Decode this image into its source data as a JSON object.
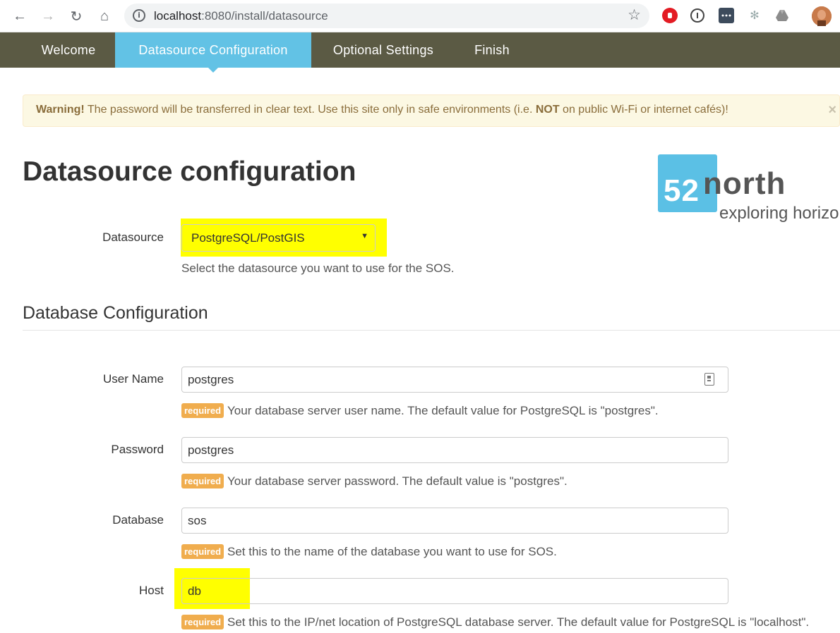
{
  "browser": {
    "url_host": "localhost",
    "url_path": ":8080/install/datasource",
    "back": "←",
    "forward": "→",
    "reload": "↻",
    "home": "⌂",
    "info_glyph": "i",
    "star": "☆",
    "extensions": [
      "stop-icon",
      "password-icon",
      "dots-icon",
      "snowflake-icon",
      "drive-icon",
      "avatar"
    ]
  },
  "nav": {
    "tabs": [
      {
        "label": "Welcome",
        "active": false
      },
      {
        "label": "Datasource Configuration",
        "active": true
      },
      {
        "label": "Optional Settings",
        "active": false
      },
      {
        "label": "Finish",
        "active": false
      }
    ],
    "active_color": "#62c2e5",
    "bar_color": "#5b5a44"
  },
  "alert": {
    "strong": "Warning!",
    "text1": " The password will be transferred in clear text. Use this site only in safe environments (i.e. ",
    "not": "NOT",
    "text2": " on public Wi-Fi or internet cafés)!",
    "close": "×"
  },
  "page_title": "Datasource configuration",
  "logo": {
    "num": "52",
    "word": "north",
    "tagline": "exploring horizons"
  },
  "datasource": {
    "label": "Datasource",
    "value": "PostgreSQL/PostGIS",
    "help": "Select the datasource you want to use for the SOS.",
    "arrow": "▼"
  },
  "section_title": "Database Configuration",
  "badge": "required",
  "fields": [
    {
      "label": "User Name",
      "value": "postgres",
      "help": "Your database server user name. The default value for PostgreSQL is \"postgres\"."
    },
    {
      "label": "Password",
      "value": "postgres",
      "help": "Your database server password. The default value is \"postgres\"."
    },
    {
      "label": "Database",
      "value": "sos",
      "help": "Set this to the name of the database you want to use for SOS."
    },
    {
      "label": "Host",
      "value": "db",
      "help": "Set this to the IP/net location of PostgreSQL database server. The default value for PostgreSQL is \"localhost\"."
    }
  ],
  "highlight_color": "#ffff00",
  "badge_color": "#f0ad4e"
}
